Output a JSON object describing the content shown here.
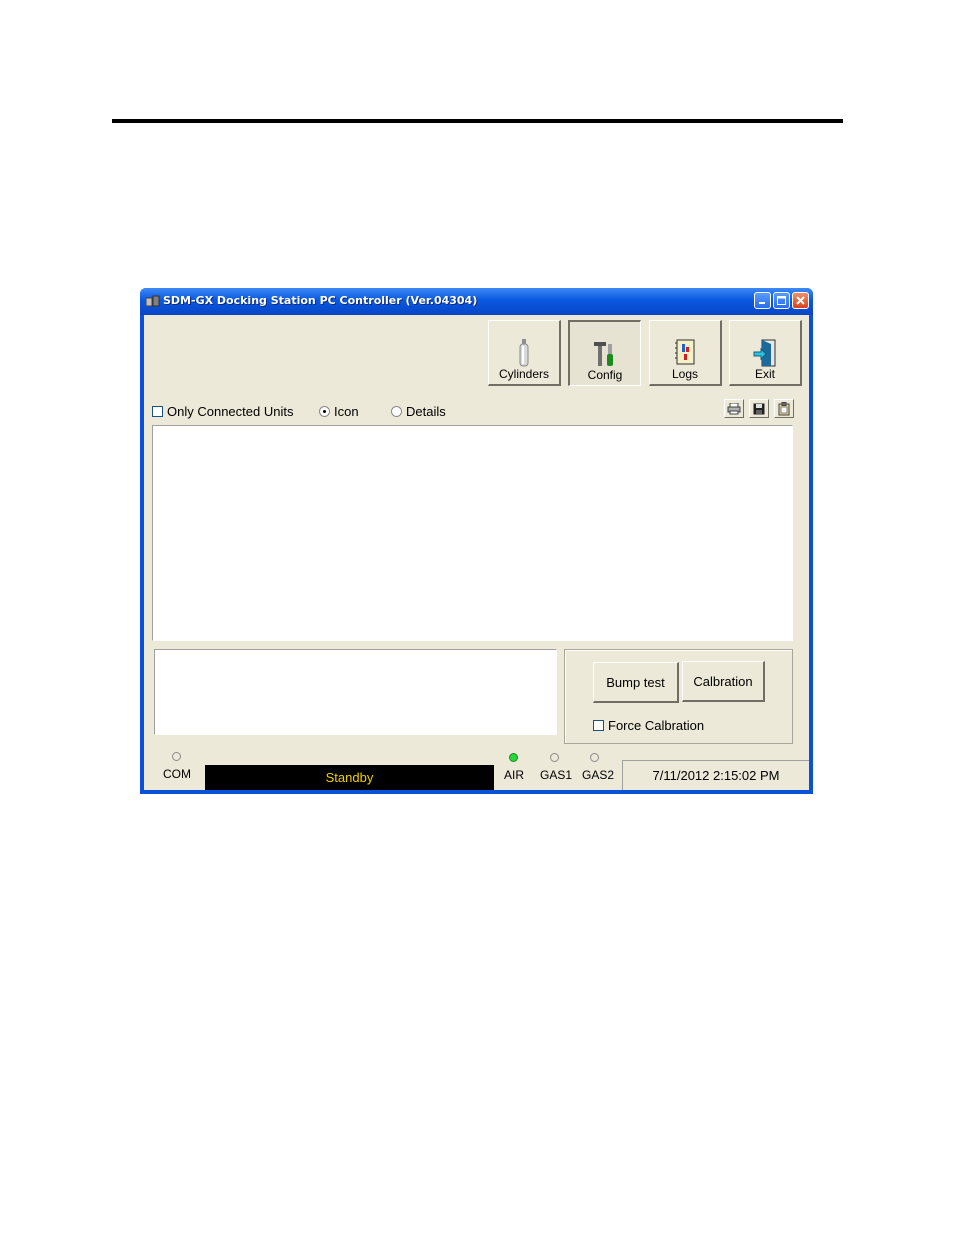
{
  "window": {
    "title": "SDM-GX Docking Station PC Controller (Ver.04304)",
    "controls": {
      "minimize": "_",
      "maximize": "□",
      "close": "✕"
    }
  },
  "toolbar": {
    "buttons": [
      {
        "label": "Cylinders",
        "icon": "cylinder-icon"
      },
      {
        "label": "Config",
        "icon": "tools-icon"
      },
      {
        "label": "Logs",
        "icon": "logbook-icon"
      },
      {
        "label": "Exit",
        "icon": "exit-door-icon"
      }
    ]
  },
  "filters": {
    "only_connected_label": "Only Connected Units",
    "only_connected_checked": false,
    "view_icon_label": "Icon",
    "view_details_label": "Details",
    "selected_view": "Icon"
  },
  "actions": {
    "bump_test_label": "Bump test",
    "calibration_label": "Calbration",
    "force_calibration_label": "Force Calbration",
    "force_calibration_checked": false
  },
  "status": {
    "com_label": "COM",
    "state_text": "Standby",
    "air_label": "AIR",
    "gas1_label": "GAS1",
    "gas2_label": "GAS2",
    "air_active": true,
    "datetime": "7/11/2012 2:15:02 PM"
  },
  "colors": {
    "titlebar": "#0a58e0",
    "client_bg": "#ece9d8",
    "status_text": "#f0d000",
    "led_on": "#27d63a"
  }
}
